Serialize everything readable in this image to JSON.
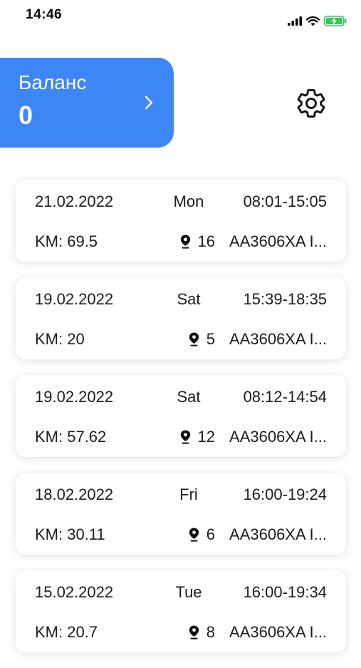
{
  "status_bar": {
    "time": "14:46"
  },
  "balance": {
    "label": "Баланс",
    "value": "0"
  },
  "colors": {
    "accent": "#3d86f5",
    "battery": "#34c759"
  },
  "trips": [
    {
      "date": "21.02.2022",
      "day": "Mon",
      "time": "08:01-15:05",
      "km": "KM: 69.5",
      "stops": "16",
      "plate": "AA3606XA I..."
    },
    {
      "date": "19.02.2022",
      "day": "Sat",
      "time": "15:39-18:35",
      "km": "KM: 20",
      "stops": "5",
      "plate": "AA3606XA I..."
    },
    {
      "date": "19.02.2022",
      "day": "Sat",
      "time": "08:12-14:54",
      "km": "KM: 57.62",
      "stops": "12",
      "plate": "AA3606XA I..."
    },
    {
      "date": "18.02.2022",
      "day": "Fri",
      "time": "16:00-19:24",
      "km": "KM: 30.11",
      "stops": "6",
      "plate": "AA3606XA I..."
    },
    {
      "date": "15.02.2022",
      "day": "Tue",
      "time": "16:00-19:34",
      "km": "KM: 20.7",
      "stops": "8",
      "plate": "AA3606XA I..."
    }
  ]
}
